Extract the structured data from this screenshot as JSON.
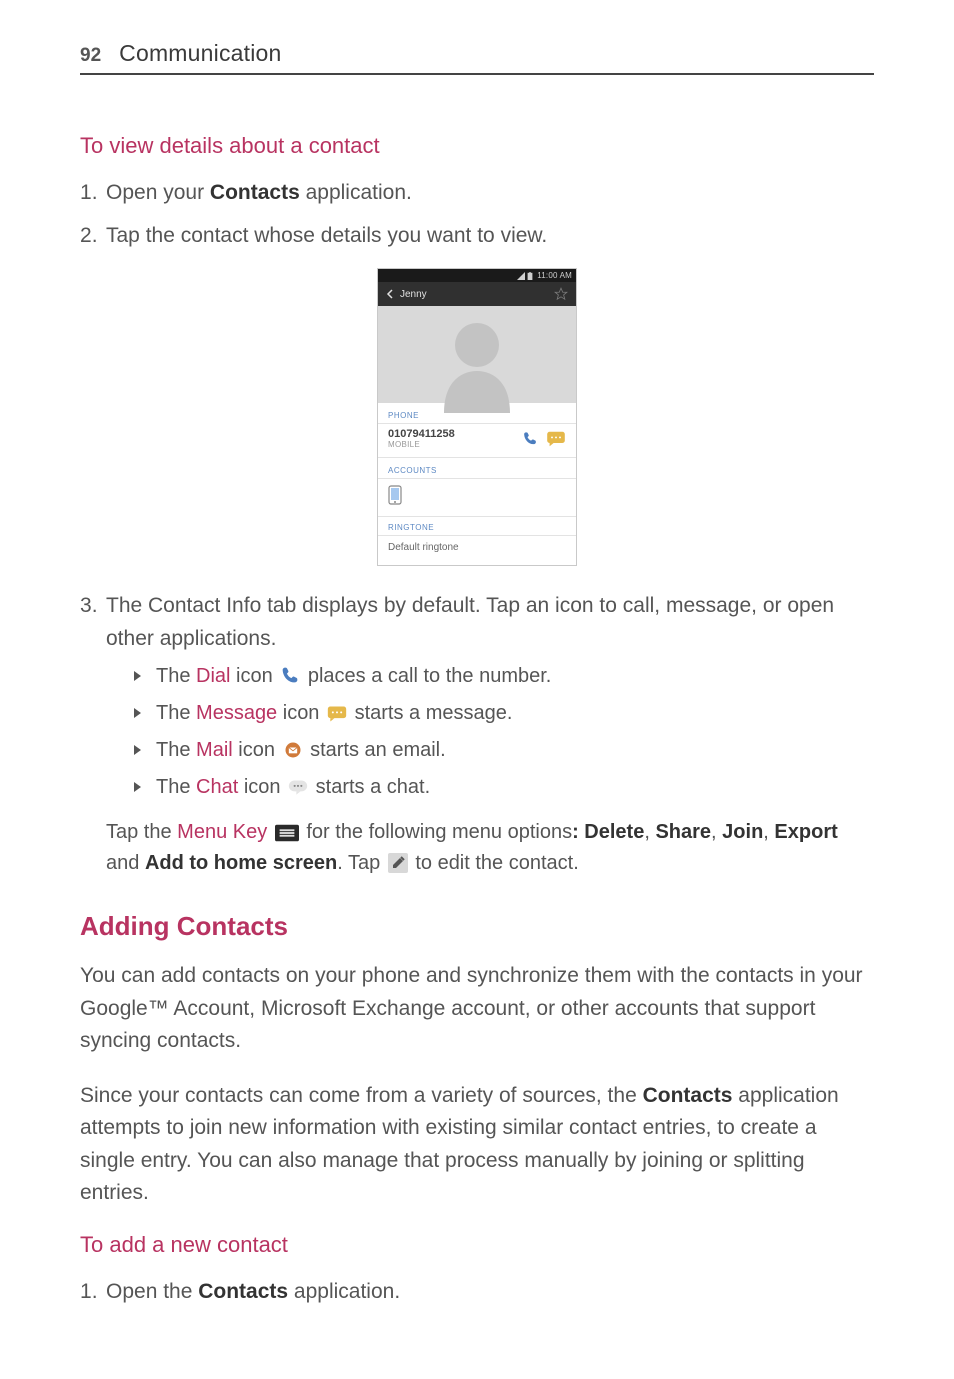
{
  "header": {
    "page_number": "92",
    "chapter": "Communication"
  },
  "section1": {
    "title": "To view details about a contact",
    "step1_prefix": "Open your ",
    "step1_bold": "Contacts",
    "step1_suffix": " application.",
    "step2": "Tap the contact whose details you want to view."
  },
  "figure": {
    "status_time": "11:00 AM",
    "contact_name": "Jenny",
    "sec_phone": "PHONE",
    "phone_number": "01079411258",
    "phone_type": "MOBILE",
    "sec_accounts": "ACCOUNTS",
    "sec_ringtone": "RINGTONE",
    "ringtone_value": "Default ringtone"
  },
  "section1b": {
    "step3_a": "The Contact Info tab displays by default. Tap an icon to call, message, or open other applications.",
    "b1_a": "The ",
    "b1_b": "Dial",
    "b1_c": " icon ",
    "b1_d": " places a call to the number.",
    "b2_a": "The ",
    "b2_b": "Message",
    "b2_c": " icon ",
    "b2_d": " starts a message.",
    "b3_a": "The ",
    "b3_b": "Mail",
    "b3_c": " icon ",
    "b3_d": " starts an email.",
    "b4_a": "The ",
    "b4_b": "Chat",
    "b4_c": " icon ",
    "b4_d": " starts a chat.",
    "tap1_a": "Tap the ",
    "tap1_b": "Menu Key",
    "tap1_c": " ",
    "tap1_d": " for the following menu options",
    "tap1_e": ": Delete",
    "tap1_f": ", ",
    "tap1_g": "Share",
    "tap1_h": ", ",
    "tap2_a": "Join",
    "tap2_b": ", ",
    "tap2_c": "Export",
    "tap2_d": " and ",
    "tap2_e": "Add to home screen",
    "tap2_f": ". Tap ",
    "tap2_g": " to edit the contact."
  },
  "section2": {
    "title": "Adding Contacts",
    "para1": "You can add contacts on your phone and synchronize them with the contacts in your Google™ Account, Microsoft Exchange account, or other accounts that support syncing contacts.",
    "para2_a": "Since your contacts can come from a variety of sources, the ",
    "para2_b": "Contacts",
    "para2_c": " application attempts to join new information with existing similar contact entries, to create a single entry. You can also manage that process manually by joining or splitting entries.",
    "sub_title": "To add a new contact",
    "step1_a": "Open the ",
    "step1_b": "Contacts",
    "step1_c": " application."
  }
}
